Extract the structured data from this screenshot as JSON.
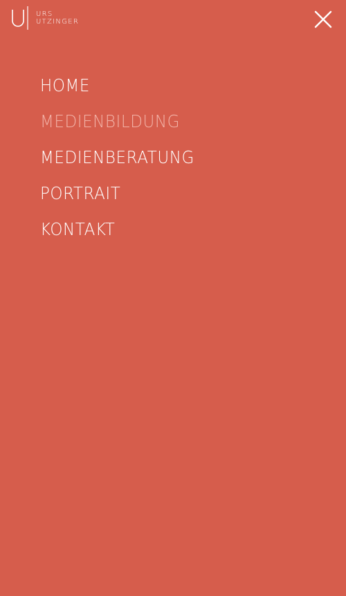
{
  "brand": {
    "line1": "URS",
    "line2": "UTZINGER",
    "logo_icon": "u-monogram-logo"
  },
  "header": {
    "close_icon": "close-icon"
  },
  "colors": {
    "background": "#d65d4c",
    "text": "#ffffff",
    "active_item": "#f2b3a8"
  },
  "menu": {
    "items": [
      {
        "label": "HOME",
        "active": false
      },
      {
        "label": "MEDIENBILDUNG",
        "active": true
      },
      {
        "label": "MEDIENBERATUNG",
        "active": false
      },
      {
        "label": "PORTRAIT",
        "active": false
      },
      {
        "label": "KONTAKT",
        "active": false
      }
    ]
  }
}
